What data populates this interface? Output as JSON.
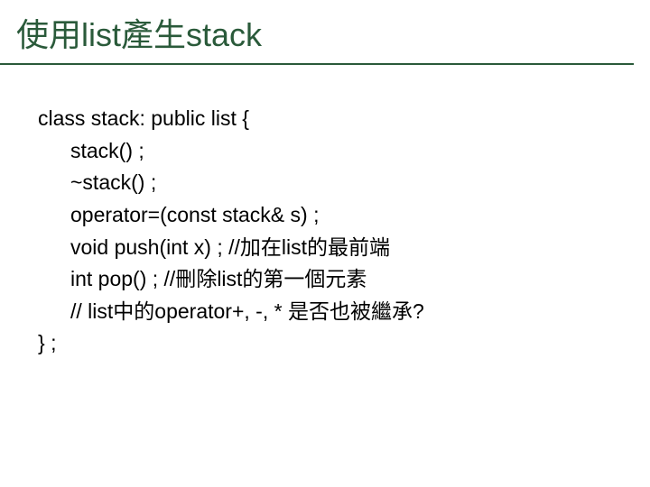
{
  "title": "使用list產生stack",
  "code": {
    "line1": "class stack: public list {",
    "line2": "stack() ;",
    "line3": "~stack() ;",
    "line4": "operator=(const stack& s) ;",
    "line5": "void push(int x) ; //加在list的最前端",
    "line6": "int pop() ; //刪除list的第一個元素",
    "line7": "// list中的operator+, -, * 是否也被繼承?",
    "line8": "} ;"
  }
}
